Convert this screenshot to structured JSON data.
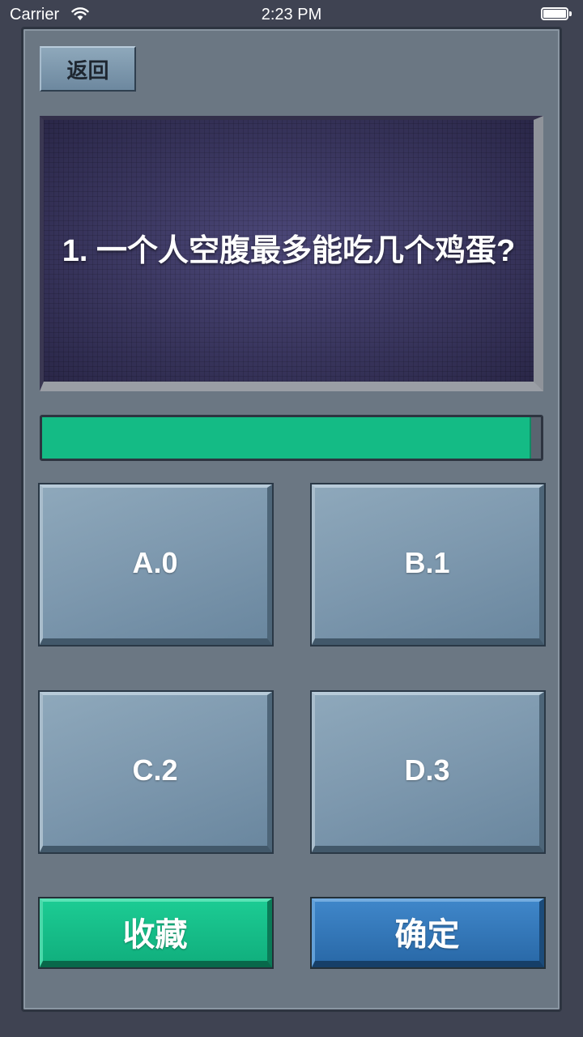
{
  "status_bar": {
    "carrier": "Carrier",
    "time": "2:23 PM"
  },
  "nav": {
    "back_label": "返回"
  },
  "question": {
    "text": "1. 一个人空腹最多能吃几个鸡蛋?"
  },
  "progress": {
    "value": 0.98,
    "color": "#14bb85"
  },
  "options": [
    {
      "label": "A.0"
    },
    {
      "label": "B.1"
    },
    {
      "label": "C.2"
    },
    {
      "label": "D.3"
    }
  ],
  "actions": {
    "favorite_label": "收藏",
    "favorite_color": "#14bb85",
    "confirm_label": "确定",
    "confirm_color": "#2f74b8"
  },
  "icons": {
    "wifi": "wifi-icon",
    "battery": "battery-icon"
  }
}
